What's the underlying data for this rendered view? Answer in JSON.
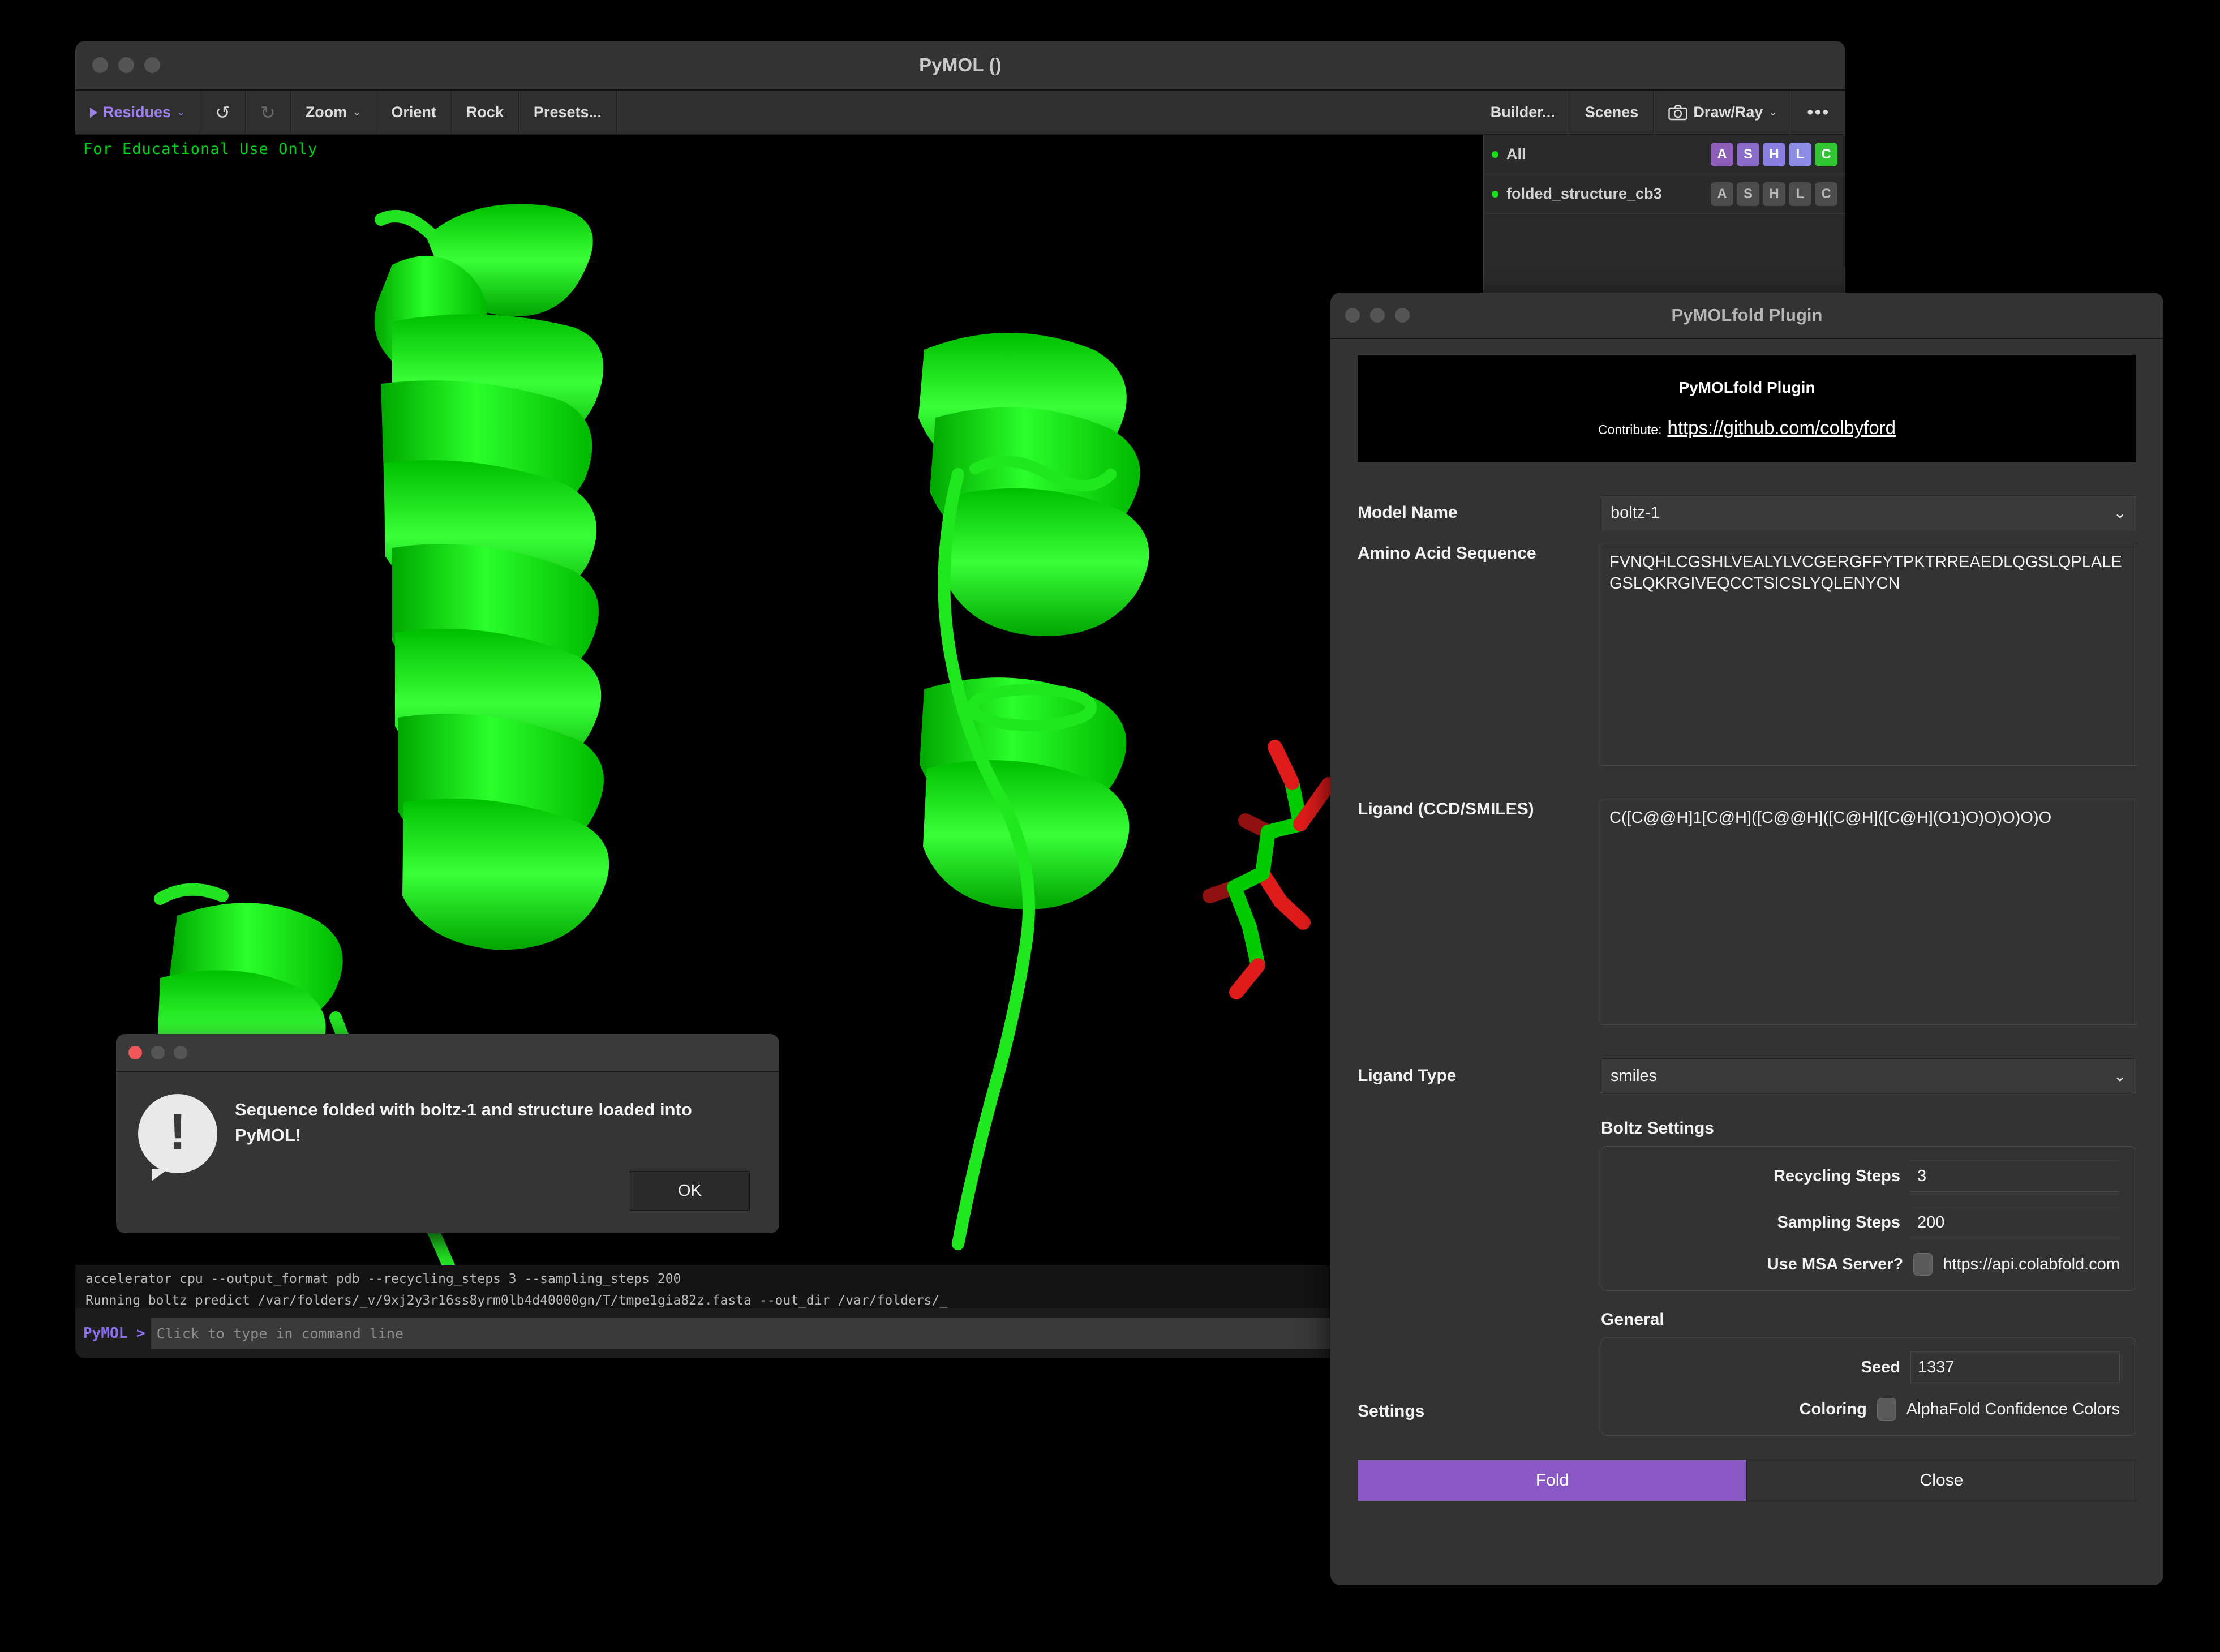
{
  "pymol_window": {
    "title": "PyMOL ()",
    "toolbar": [
      {
        "label": "Residues",
        "icon": "play-triangle-icon",
        "caret": "⌄",
        "accent": true
      },
      {
        "label": "",
        "icon": "undo-icon"
      },
      {
        "label": "",
        "icon": "redo-icon"
      },
      {
        "label": "Zoom",
        "caret": "⌄"
      },
      {
        "label": "Orient"
      },
      {
        "label": "Rock"
      },
      {
        "label": "Presets..."
      }
    ],
    "toolbar_right": [
      {
        "label": "Builder..."
      },
      {
        "label": "Scenes"
      },
      {
        "label": "Draw/Ray",
        "icon": "camera-icon",
        "caret": "⌄"
      },
      {
        "label": "•••",
        "icon": "overflow-menu-icon"
      }
    ],
    "viewport": {
      "watermark": "For Educational Use Only",
      "background": "#000000",
      "ribbon_color": "#00cc00",
      "ligand_carbon_color": "#00cc00",
      "ligand_oxygen_color": "#e01b1b"
    },
    "object_panel": {
      "rows": [
        {
          "name": "All",
          "enabled": true,
          "reps": [
            {
              "label": "A",
              "color": "#8e5fb8",
              "active": true
            },
            {
              "label": "S",
              "color": "#8b6cc9",
              "active": true
            },
            {
              "label": "H",
              "color": "#8a7ee0",
              "active": true
            },
            {
              "label": "L",
              "color": "#8b8ce6",
              "active": true
            },
            {
              "label": "C",
              "color": "#33c433",
              "active": true
            }
          ]
        },
        {
          "name": "folded_structure_cb3",
          "enabled": true,
          "reps": [
            {
              "label": "A",
              "active": false
            },
            {
              "label": "S",
              "active": false
            },
            {
              "label": "H",
              "active": false
            },
            {
              "label": "L",
              "active": false
            },
            {
              "label": "C",
              "active": false
            }
          ]
        }
      ]
    },
    "console": {
      "lines": [
        "accelerator cpu --output_format pdb --recycling_steps 3 --sampling_steps 200",
        "Running boltz predict /var/folders/_v/9xj2y3r16ss8yrm0lb4d40000gn/T/tmpe1gia82z.fasta --out_dir /var/folders/_",
        "accelerator cpu --output_format pdb --recycling_steps 3 --sampling_steps 200"
      ],
      "prompt": "PyMOL >",
      "placeholder": "Click to type in command line",
      "input_value": ""
    }
  },
  "alert_dialog": {
    "icon": "exclamation-bubble-icon",
    "message": "Sequence folded with boltz-1 and structure loaded into PyMOL!",
    "ok_label": "OK"
  },
  "plugin_dialog": {
    "title": "PyMOLfold Plugin",
    "banner": {
      "title": "PyMOLfold Plugin",
      "contribute_label": "Contribute:",
      "link": "https://github.com/colbyford"
    },
    "model_name": {
      "label": "Model Name",
      "value": "boltz-1"
    },
    "amino_acid_sequence": {
      "label": "Amino Acid Sequence",
      "value": "FVNQHLCGSHLVEALYLVCGERGFFYTPKTRREAEDLQGSLQPLALEGSLQKRGIVEQCCTSICSLYQLENYCN"
    },
    "ligand": {
      "label": "Ligand (CCD/SMILES)",
      "value": "C([C@@H]1[C@H]([C@@H]([C@H]([C@H](O1)O)O)O)O)O"
    },
    "ligand_type": {
      "label": "Ligand Type",
      "value": "smiles"
    },
    "settings": {
      "label": "Settings",
      "boltz": {
        "title": "Boltz Settings",
        "recycling_steps": {
          "label": "Recycling Steps",
          "value": "3"
        },
        "sampling_steps": {
          "label": "Sampling Steps",
          "value": "200"
        },
        "use_msa_server": {
          "label": "Use MSA Server?",
          "checked": false,
          "url": "https://api.colabfold.com"
        }
      }
    },
    "general": {
      "title": "General",
      "seed": {
        "label": "Seed",
        "value": "1337"
      },
      "coloring": {
        "label": "Coloring",
        "checkbox_label": "AlphaFold Confidence Colors",
        "checked": false
      }
    },
    "buttons": {
      "fold": "Fold",
      "close": "Close",
      "fold_color": "#8a58c4"
    }
  }
}
